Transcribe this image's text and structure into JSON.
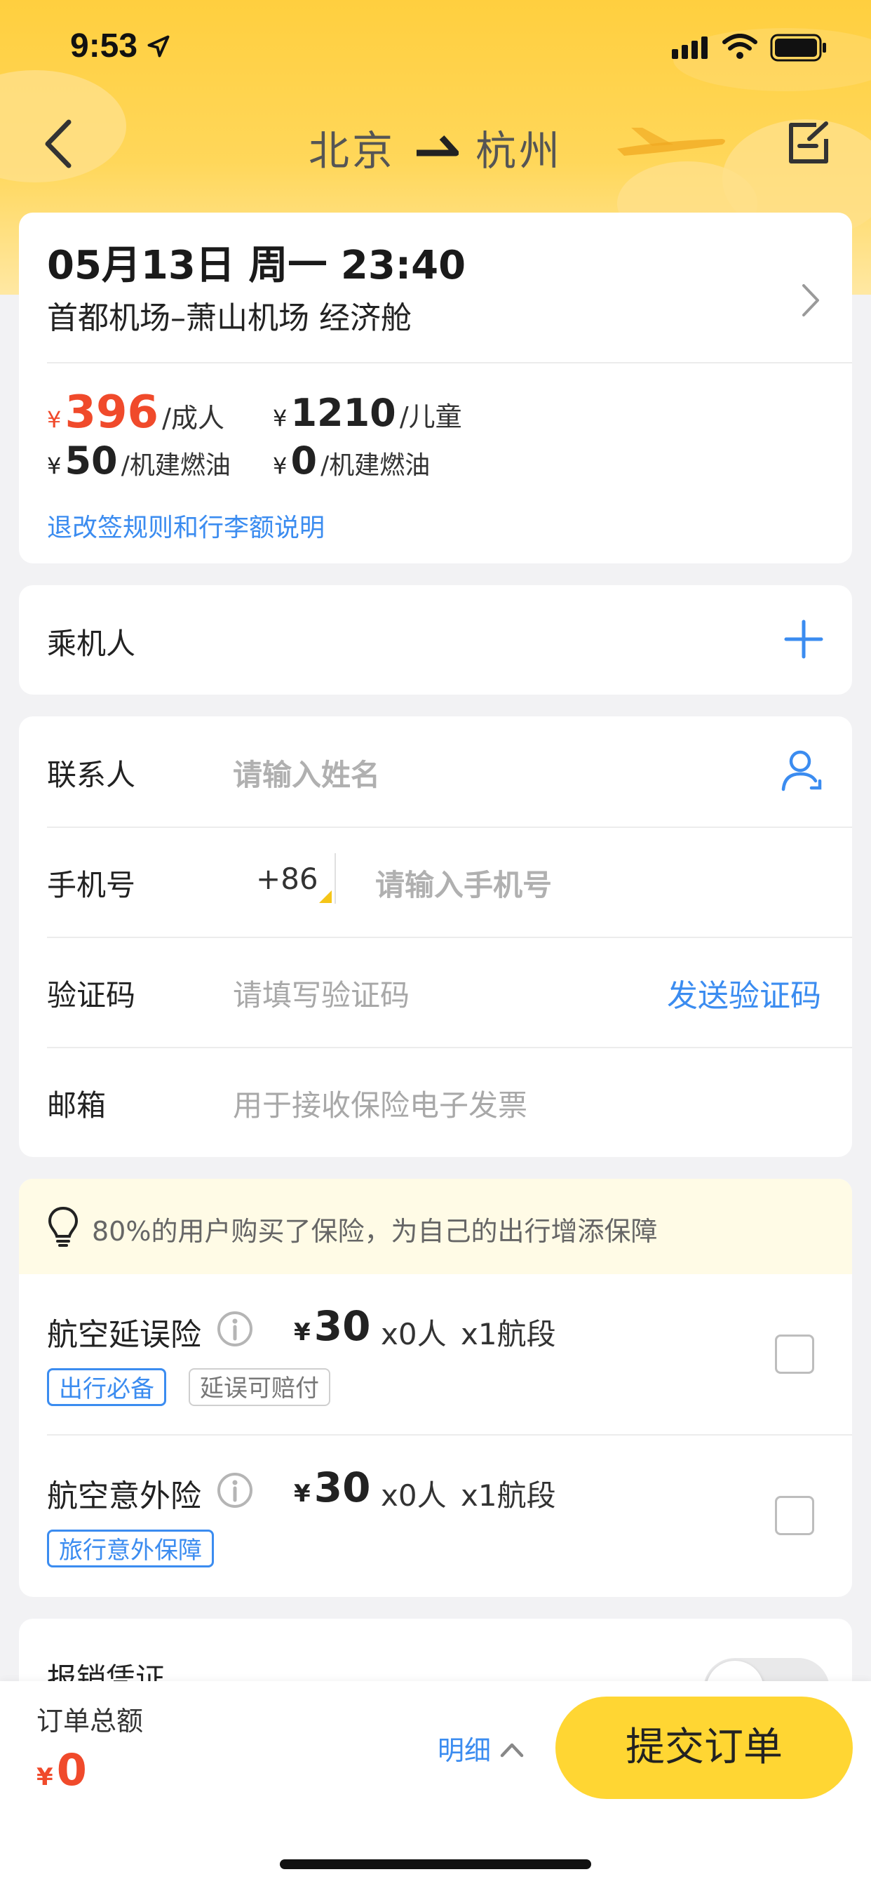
{
  "status_bar": {
    "time": "9:53"
  },
  "header": {
    "from": "北京",
    "to": "杭州"
  },
  "flight": {
    "datetime": "05月13日 周一 23:40",
    "route": "首都机场–萧山机场 经济舱",
    "currency": "¥",
    "adult_price": "396",
    "adult_label": "/成人",
    "child_price": "1210",
    "child_label": "/儿童",
    "adult_fuel": "50",
    "child_fuel": "0",
    "fuel_label": "/机建燃油",
    "rules_link": "退改签规则和行李额说明"
  },
  "passengers": {
    "label": "乘机人"
  },
  "contact": {
    "name_label": "联系人",
    "name_placeholder": "请输入姓名",
    "phone_label": "手机号",
    "country_code": "+86",
    "phone_placeholder": "请输入手机号",
    "code_label": "验证码",
    "code_placeholder": "请填写验证码",
    "send_code": "发送验证码",
    "email_label": "邮箱",
    "email_placeholder": "用于接收保险电子发票"
  },
  "insurance": {
    "tip": "80%的用户购买了保险，为自己的出行增添保障",
    "items": [
      {
        "name": "航空延误险",
        "currency": "¥",
        "price": "30",
        "persons": "x0人",
        "segments": "x1航段",
        "tags": [
          "出行必备",
          "延误可赔付"
        ]
      },
      {
        "name": "航空意外险",
        "currency": "¥",
        "price": "30",
        "persons": "x0人",
        "segments": "x1航段",
        "tags": [
          "旅行意外保障"
        ]
      }
    ]
  },
  "invoice": {
    "label": "报销凭证"
  },
  "footer": {
    "total_label": "订单总额",
    "currency": "¥",
    "total": "0",
    "detail": "明细",
    "submit": "提交订单"
  },
  "colors": {
    "accent_yellow": "#ffd633",
    "price_red": "#f04a2b",
    "link_blue": "#3b8cf0",
    "tip_bg": "#fffbe6"
  }
}
